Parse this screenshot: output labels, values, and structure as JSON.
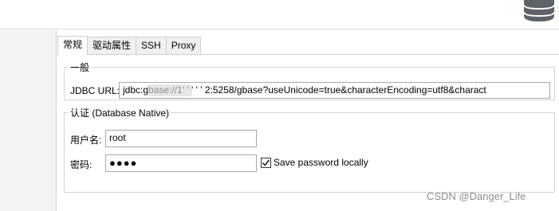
{
  "tabs": [
    {
      "label": "常规"
    },
    {
      "label": "驱动属性"
    },
    {
      "label": "SSH"
    },
    {
      "label": "Proxy"
    }
  ],
  "general": {
    "legend": "一般",
    "jdbc_url_label": "JDBC URL:",
    "jdbc_url_value": "jdbc:gbase://1'   ' ' ' ' 2:5258/gbase?useUnicode=true&characterEncoding=utf8&charact"
  },
  "auth": {
    "legend": "认证 (Database Native)",
    "username_label": "用户名:",
    "username_value": "root",
    "password_label": "密码:",
    "password_value": "●●●●",
    "save_password_label": "Save password locally",
    "save_password_checked": true
  },
  "watermark": "CSDN @Danger_Life",
  "icons": {
    "top_right": "database-icon",
    "checkbox": "checkmark-icon"
  }
}
